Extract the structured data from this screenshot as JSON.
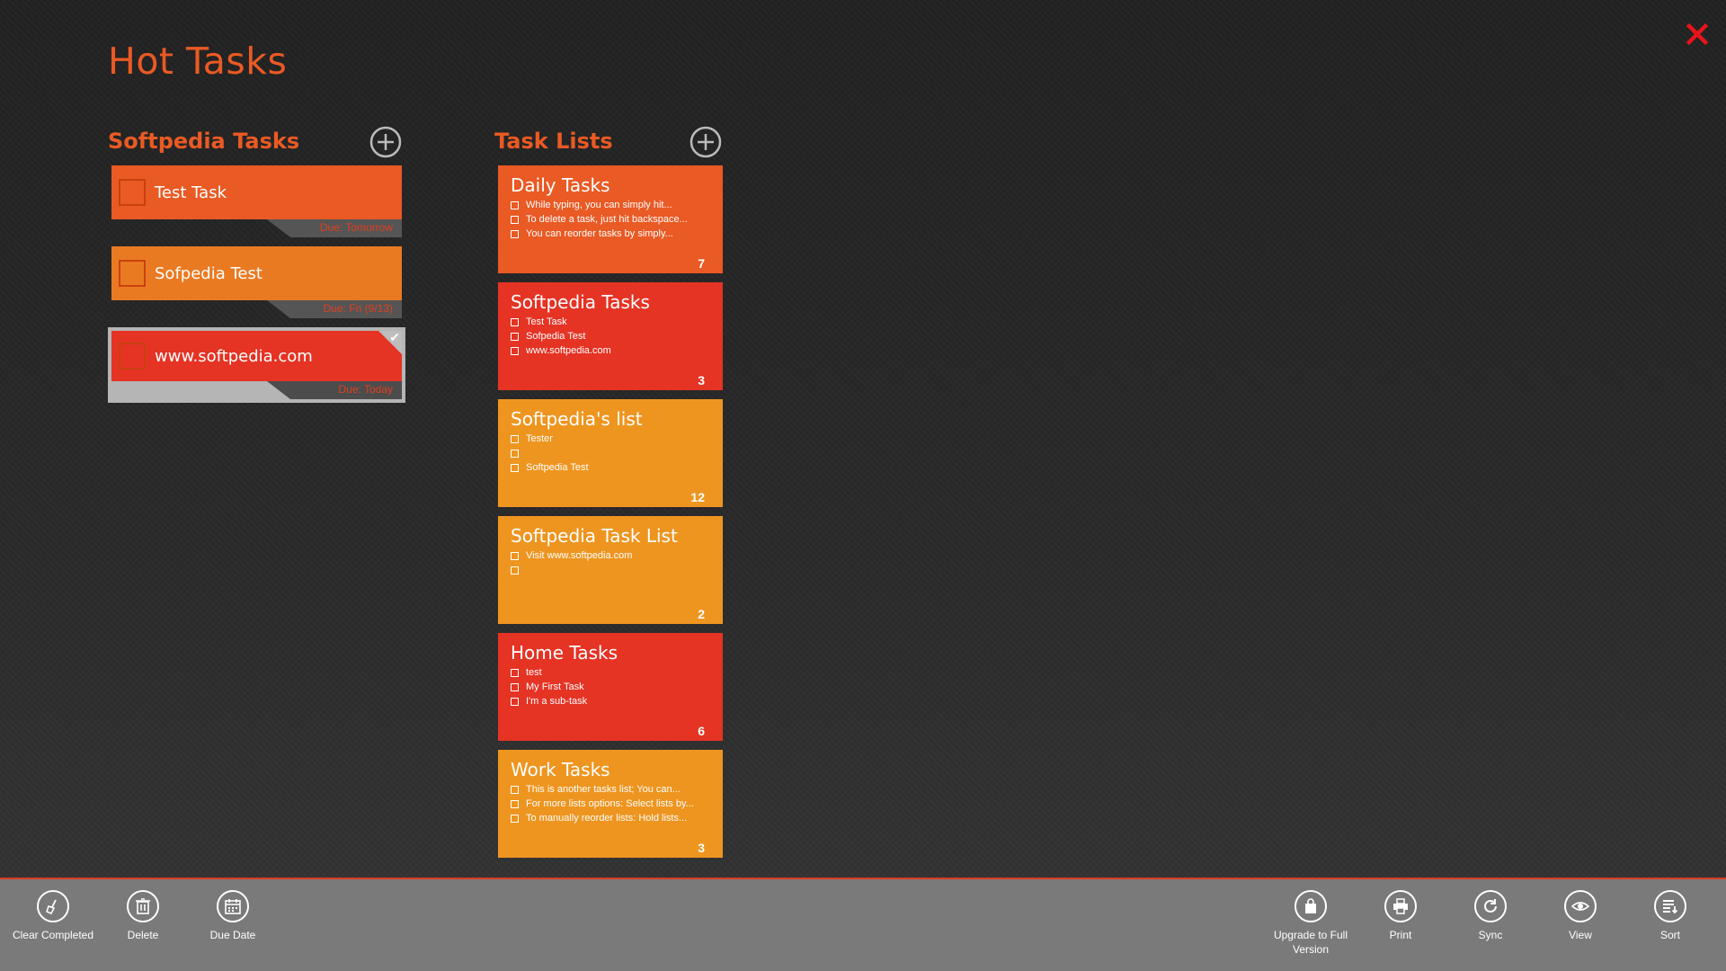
{
  "app": {
    "title": "Hot Tasks"
  },
  "tasks_section": {
    "heading": "Softpedia Tasks"
  },
  "tasks": [
    {
      "name": "Test Task",
      "due": "Due: Tomorrow",
      "color": "#e95a24",
      "selected": false
    },
    {
      "name": "Sofpedia Test",
      "due": "Due: Fri (9/13)",
      "color": "#ea7a22",
      "selected": false
    },
    {
      "name": "www.softpedia.com",
      "due": "Due: Today",
      "color": "#e53324",
      "selected": true
    }
  ],
  "lists_section": {
    "heading": "Task Lists"
  },
  "lists": [
    {
      "title": "Daily Tasks",
      "color": "#e95a24",
      "count": "7",
      "items": [
        "While typing, you can simply hit...",
        "To delete a task, just hit backspace...",
        "You can reorder tasks by simply..."
      ]
    },
    {
      "title": "Softpedia Tasks",
      "color": "#e53324",
      "count": "3",
      "items": [
        "Test Task",
        "Sofpedia Test",
        "www.softpedia.com"
      ]
    },
    {
      "title": "Softpedia's list",
      "color": "#ee9520",
      "count": "12",
      "items": [
        "Tester",
        "",
        "Softpedia Test"
      ]
    },
    {
      "title": "Softpedia Task List",
      "color": "#ee9520",
      "count": "2",
      "items": [
        "Visit www.softpedia.com",
        ""
      ]
    },
    {
      "title": "Home Tasks",
      "color": "#e53324",
      "count": "6",
      "items": [
        "test",
        "My First Task",
        "I'm a sub-task"
      ]
    },
    {
      "title": "Work Tasks",
      "color": "#ee9520",
      "count": "3",
      "items": [
        "This is another tasks list; You can...",
        "For more lists options: Select lists by...",
        "To manually reorder lists: Hold lists..."
      ]
    }
  ],
  "app_bar": {
    "left": [
      {
        "label": "Clear Completed",
        "icon": "broom-icon"
      },
      {
        "label": "Delete",
        "icon": "trash-icon"
      },
      {
        "label": "Due Date",
        "icon": "calendar-icon"
      }
    ],
    "right": [
      {
        "label": "Upgrade to Full Version",
        "icon": "shopping-bag-icon"
      },
      {
        "label": "Print",
        "icon": "printer-icon"
      },
      {
        "label": "Sync",
        "icon": "sync-icon"
      },
      {
        "label": "View",
        "icon": "eye-icon"
      },
      {
        "label": "Sort",
        "icon": "sort-icon"
      }
    ]
  },
  "colors": {
    "accent": "#ea5a24",
    "close": "#e8141b",
    "app_bar": "#7a7a7a",
    "app_bar_border": "#d93a1f"
  }
}
